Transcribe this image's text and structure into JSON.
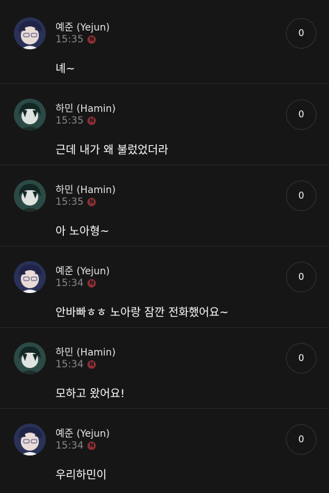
{
  "colors": {
    "background": "#161617",
    "divider": "#262628",
    "timestamp": "#8a8a8d",
    "badge": "#8e2f33"
  },
  "posts": [
    {
      "author": "예준 (Yejun)",
      "time": "15:35",
      "badge": "N",
      "message": "녜~",
      "count": "0",
      "avatar": "yejun-avatar"
    },
    {
      "author": "하민 (Hamin)",
      "time": "15:35",
      "badge": "N",
      "message": "근데 내가 왜 불렀었더라",
      "count": "0",
      "avatar": "hamin-avatar"
    },
    {
      "author": "하민 (Hamin)",
      "time": "15:35",
      "badge": "N",
      "message": "아 노아형~",
      "count": "0",
      "avatar": "hamin-avatar"
    },
    {
      "author": "예준 (Yejun)",
      "time": "15:34",
      "badge": "N",
      "message": "안바빠ㅎㅎ 노아랑 잠깐 전화했어요~",
      "count": "0",
      "avatar": "yejun-avatar"
    },
    {
      "author": "하민 (Hamin)",
      "time": "15:34",
      "badge": "N",
      "message": "모하고 왔어요!",
      "count": "0",
      "avatar": "hamin-avatar"
    },
    {
      "author": "예준 (Yejun)",
      "time": "15:34",
      "badge": "N",
      "message": "우리하민이",
      "count": "0",
      "avatar": "yejun-avatar"
    }
  ]
}
